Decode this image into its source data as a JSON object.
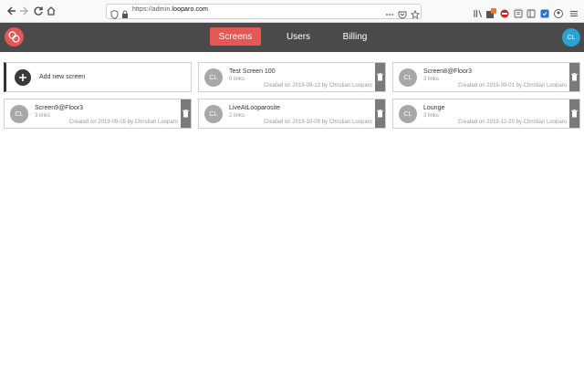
{
  "browser": {
    "url_prefix": "https://admin.",
    "url_host": "looparo.com"
  },
  "header": {
    "tabs": [
      {
        "label": "Screens",
        "active": true
      },
      {
        "label": "Users",
        "active": false
      },
      {
        "label": "Billing",
        "active": false
      }
    ],
    "user_initials": "CL",
    "accent_color": "#e55753",
    "avatar_color": "#2aa2d6"
  },
  "add_screen_label": "Add new screen",
  "screens": [
    {
      "initials": "CL",
      "name": "Test Screen 100",
      "links": "0 links",
      "meta": "Created on 2019-09-13 by Christian Looparo"
    },
    {
      "initials": "CL",
      "name": "Screen8@Floor3",
      "links": "3 links",
      "meta": "Created on 2019-09-01 by Christian Looparo"
    },
    {
      "initials": "CL",
      "name": "Screen9@Floor3",
      "links": "3 links",
      "meta": "Created on 2019-09-05 by Christian Looparo"
    },
    {
      "initials": "CL",
      "name": "LiveAtLooparosite",
      "links": "2 links",
      "meta": "Created on 2019-10-09 by Christian Looparo"
    },
    {
      "initials": "CL",
      "name": "Lounge",
      "links": "3 links",
      "meta": "Created on 2019-12-20 by Christian Looparo"
    }
  ]
}
